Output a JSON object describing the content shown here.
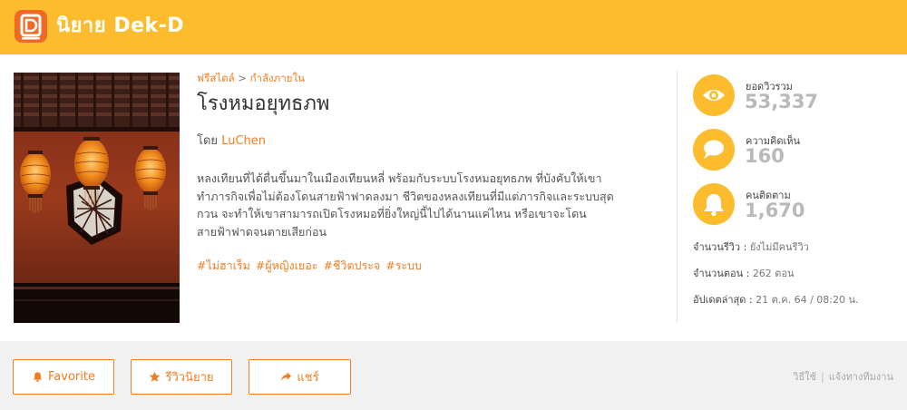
{
  "header": {
    "logo_text": "นิยาย Dek-D",
    "logo_badge_letter": "D",
    "background_color": "#fcbc2e"
  },
  "cover": {
    "icon": "cover-art-lanterns"
  },
  "novel": {
    "category": "ฟรีสไตล์",
    "breadcrumb_separator": ">",
    "subcategory": "กำลังภายใน",
    "title": "โรงหมอยุทธภพ",
    "author_prefix": "โดย",
    "author": "LuChen",
    "description_lines": [
      "หลงเทียนที่ได้ตื่นขึ้นมาในเมืองเทียนหลี่ พร้อมกับระบบโรงหมอยุทธภพ ที่บังคับให้เขา",
      "ทำภารกิจเพื่อไม่ต้องโดนสายฟ้าฟาดลงมา ชีวิตของหลงเทียนที่มีแต่ภารกิจและระบบสุด",
      "กวน จะทำให้เขาสามารถเปิดโรงหมอที่ยิ่งใหญ่นี้ไปได้นานแค่ไหน หรือเขาจะโดน",
      "สายฟ้าฟาดจนตายเสียก่อน"
    ],
    "tags": [
      "#ไม่ฮาเร็ม",
      "#ผู้หญิงเยอะ",
      "#ชีวิตประจ",
      "#ระบบ"
    ]
  },
  "stats": [
    {
      "label": "ยอดวิวรวม",
      "value": "53,337",
      "icon": "eye-icon"
    },
    {
      "label": "ความคิดเห็น",
      "value": "160",
      "icon": "comment-icon"
    },
    {
      "label": "คนติดตาม",
      "value": "1,670",
      "icon": "bell-icon"
    }
  ],
  "info": {
    "reviews_label": "จำนวนรีวิว :",
    "reviews_value": "ยังไม่มีคนรีวิว",
    "episodes_label": "จำนวนตอน :",
    "episodes_value": "262 ตอน",
    "updated_label": "อัปเดตล่าสุด :",
    "updated_value": "21 ต.ค. 64 / 08:20 น."
  },
  "actions": {
    "favorite": "Favorite",
    "review": "รีวิวนิยาย",
    "share": "แชร์"
  },
  "footer": {
    "help": "วิธีใช้",
    "separator": "|",
    "report": "แจ้งทางทีมงาน"
  },
  "colors": {
    "brand": "#fcbc2e",
    "accent": "#ef7d22",
    "logo_badge": "#ef6a26",
    "stat_value": "#b9b9b9"
  }
}
